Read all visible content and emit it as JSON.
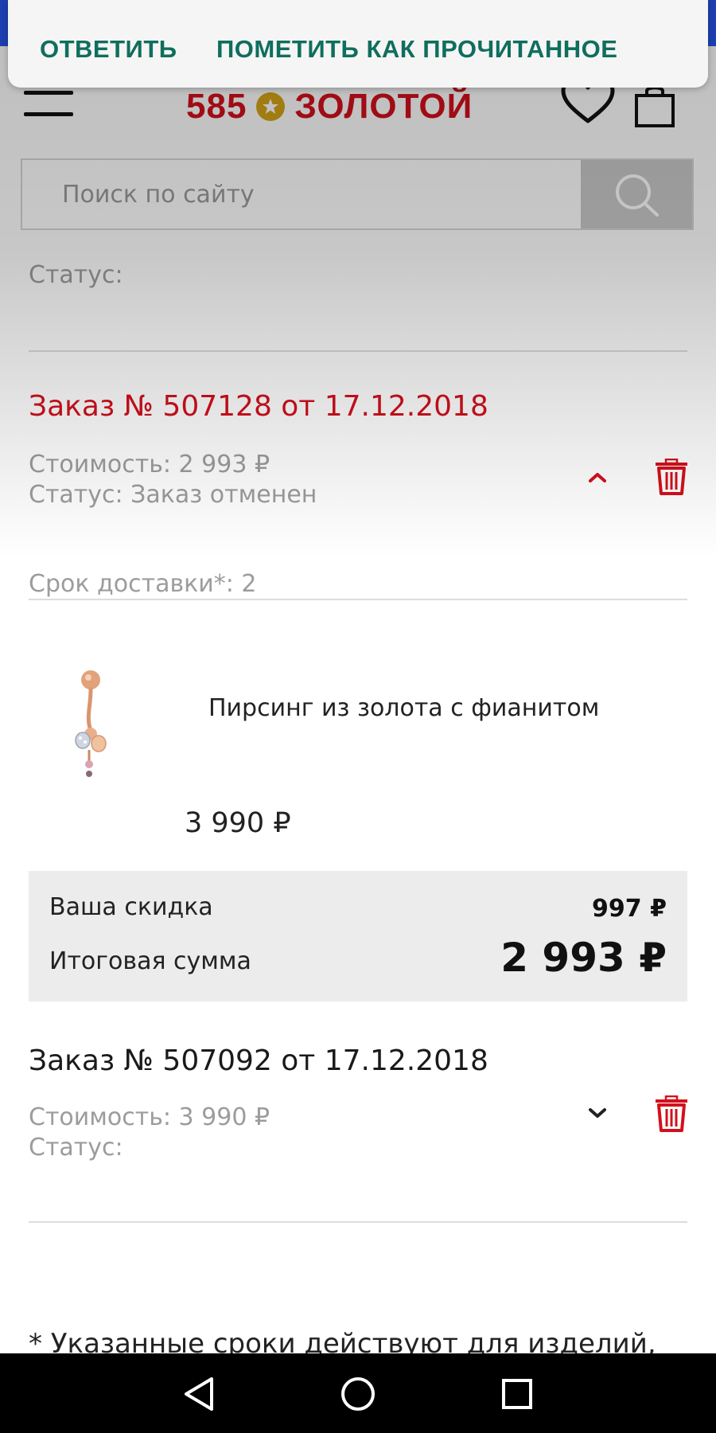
{
  "notification": {
    "reply_label": "ОТВЕТИТЬ",
    "mark_read_label": "ПОМЕТИТЬ КАК ПРОЧИТАННОЕ"
  },
  "header": {
    "logo_left": "585",
    "logo_right": "ЗОЛОТОЙ",
    "icons": [
      "menu-icon",
      "heart-icon",
      "shopping-bag-icon"
    ]
  },
  "search": {
    "placeholder": "Поиск по сайту",
    "button_icon": "search-icon"
  },
  "previous_status": "Статус:",
  "orders": [
    {
      "title": "Заказ № 507128 от 17.12.2018",
      "cost": "Стоимость: 2 993 ₽",
      "status": "Статус: Заказ отменен",
      "expanded": true,
      "delivery": "Срок доставки*: 2",
      "product": {
        "name": "Пирсинг из золота с фианитом",
        "price": "3 990 ₽"
      },
      "summary": {
        "discount_label": "Ваша скидка",
        "discount_value": "997 ₽",
        "total_label": "Итоговая сумма",
        "total_value": "2 993 ₽"
      }
    },
    {
      "title": "Заказ № 507092 от 17.12.2018",
      "cost": "Стоимость: 3 990 ₽",
      "status": "Статус:",
      "expanded": false
    }
  ],
  "footnote": "* Указанные сроки действуют для изделий,",
  "colors": {
    "brand_red": "#d3101c",
    "notification_green": "#0f6e5d",
    "status_bar_blue": "#1d3fb0",
    "logo_gold": "#d4a416"
  }
}
